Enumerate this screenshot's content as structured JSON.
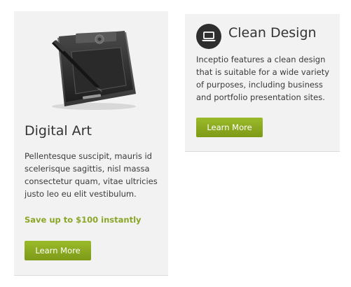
{
  "cards": [
    {
      "icon": "tablet-illustration",
      "title": "Digital Art",
      "text": "Pellentesque suscipit, mauris id scelerisque sagittis, nisl massa consectetur quam, vitae ultricies justo leo eu elit vestibulum.",
      "promo": "Save up to $100 instantly",
      "button_label": "Learn More"
    },
    {
      "icon": "laptop-icon",
      "title": "Clean Design",
      "text": "Inceptio features a clean design that is suitable for a wide variety of purposes, including business and portfolio presentation sites.",
      "button_label": "Learn More"
    }
  ],
  "colors": {
    "card_background": "#f2f2f2",
    "accent_green": "#8aa626",
    "button_green": "#86a41f",
    "icon_circle": "#2e2e2e"
  }
}
